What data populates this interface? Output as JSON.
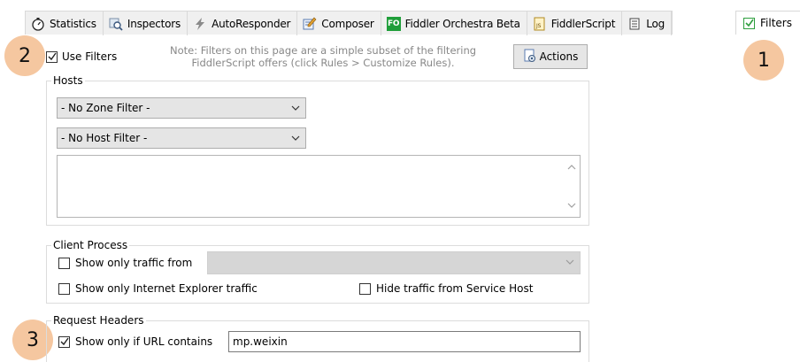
{
  "tabs": [
    {
      "label": "Statistics",
      "icon": "stopwatch-icon"
    },
    {
      "label": "Inspectors",
      "icon": "inspectors-icon"
    },
    {
      "label": "AutoResponder",
      "icon": "lightning-icon"
    },
    {
      "label": "Composer",
      "icon": "composer-icon"
    },
    {
      "label": "Fiddler Orchestra Beta",
      "icon": "fo-icon",
      "icon_text": "FO"
    },
    {
      "label": "FiddlerScript",
      "icon": "script-icon",
      "icon_text": "JS"
    },
    {
      "label": "Log",
      "icon": "log-icon"
    }
  ],
  "filters_tab": {
    "label": "Filters",
    "checked": true
  },
  "badges": {
    "one": "1",
    "two": "2",
    "three": "3"
  },
  "use_filters": {
    "label": "Use Filters",
    "checked": true
  },
  "note": {
    "line1": "Note: Filters on this page are a simple subset of the filtering",
    "line2": "FiddlerScript offers (click Rules > Customize Rules)."
  },
  "actions_button": {
    "label": "Actions"
  },
  "hosts": {
    "title": "Hosts",
    "zone_filter": "- No Zone Filter -",
    "host_filter": "- No Host Filter -"
  },
  "client_process": {
    "title": "Client Process",
    "show_only_from": "Show only traffic from",
    "show_only_ie": "Show only Internet Explorer traffic",
    "hide_service_host": "Hide traffic from Service Host"
  },
  "request_headers": {
    "title": "Request Headers",
    "url_contains_label": "Show only if URL contains",
    "url_contains_checked": true,
    "url_contains_value": "mp.weixin"
  },
  "colors": {
    "badge": "#f5c7a0",
    "check_green": "#2e9e3e",
    "fo_green": "#1f9e3a"
  }
}
